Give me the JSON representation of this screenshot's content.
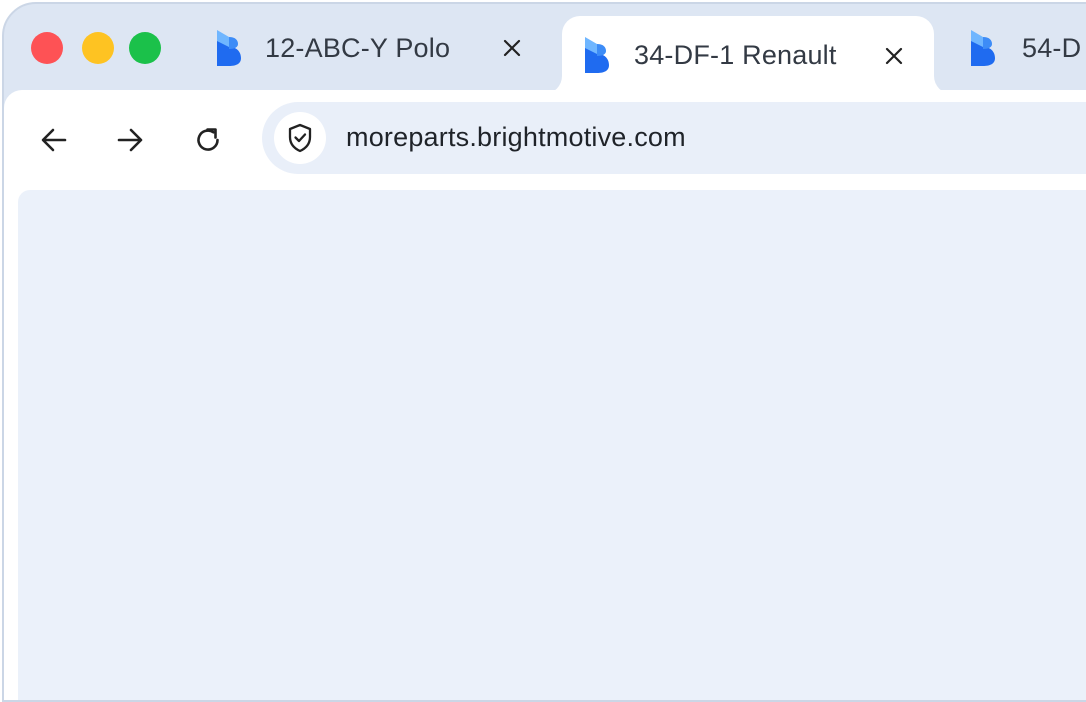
{
  "window": {
    "traffic_lights": {
      "close_color": "#fe5255",
      "minimize_color": "#fec322",
      "maximize_color": "#1bc14a"
    }
  },
  "tabs": [
    {
      "title": "12-ABC-Y Polo",
      "icon": "brightmotive-logo-icon",
      "active": false
    },
    {
      "title": "34-DF-1 Renault",
      "icon": "brightmotive-logo-icon",
      "active": true
    },
    {
      "title": "54-D",
      "icon": "brightmotive-logo-icon",
      "active": false
    }
  ],
  "toolbar": {
    "back_icon": "arrow-left-icon",
    "forward_icon": "arrow-right-icon",
    "reload_icon": "reload-icon"
  },
  "address_bar": {
    "security_icon": "shield-check-icon",
    "url": "moreparts.brightmotive.com"
  },
  "colors": {
    "brand_blue": "#1f6bf0",
    "brand_blue_light": "#6fb6ff",
    "chrome_background": "#dde6f3",
    "page_background": "#ebf1fa"
  }
}
